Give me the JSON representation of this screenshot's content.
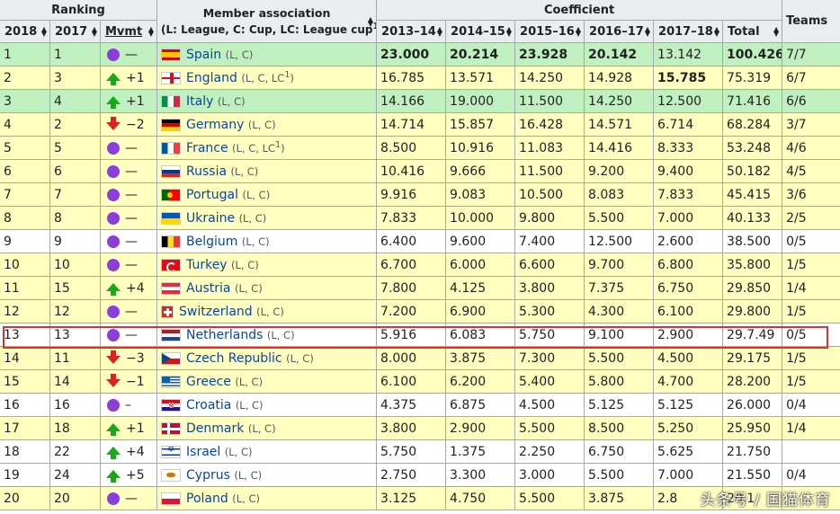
{
  "headers": {
    "ranking": "Ranking",
    "member_association": "Member association",
    "member_sub_prefix": "(L: League, C: Cup, LC: League cup",
    "member_sub_sup": "1",
    "member_sub_suffix": ")",
    "coefficient": "Coefficient",
    "teams": "Teams",
    "col_2018": "2018",
    "col_2017": "2017",
    "col_mvmt": "Mvmt",
    "col_1314": "2013–14",
    "col_1415": "2014–15",
    "col_1516": "2015–16",
    "col_1617": "2016–17",
    "col_1718": "2017–18",
    "col_total": "Total"
  },
  "rows": [
    {
      "r18": "1",
      "r17": "1",
      "icon": "dot-icon",
      "mv": "—",
      "flag": "es",
      "flag_icon": "spain-flag-icon",
      "country": "Spain",
      "sfx": "(L, C)",
      "sup": "",
      "c1314": "23.000",
      "c1415": "20.214",
      "c1516": "23.928",
      "c1617": "20.142",
      "c1718": "13.142",
      "total": "100.426",
      "teams": "7/7"
    },
    {
      "r18": "2",
      "r17": "3",
      "icon": "up-arrow-icon",
      "mv": "+1",
      "flag": "en",
      "flag_icon": "england-flag-icon",
      "country": "England",
      "sfx": "(L, C, LC",
      "sup": "1",
      "c1314": "16.785",
      "c1415": "13.571",
      "c1516": "14.250",
      "c1617": "14.928",
      "c1718": "15.785",
      "total": "75.319",
      "teams": "6/7"
    },
    {
      "r18": "3",
      "r17": "4",
      "icon": "up-arrow-icon",
      "mv": "+1",
      "flag": "it",
      "flag_icon": "italy-flag-icon",
      "country": "Italy",
      "sfx": "(L, C)",
      "sup": "",
      "c1314": "14.166",
      "c1415": "19.000",
      "c1516": "11.500",
      "c1617": "14.250",
      "c1718": "12.500",
      "total": "71.416",
      "teams": "6/6"
    },
    {
      "r18": "4",
      "r17": "2",
      "icon": "down-arrow-icon",
      "mv": "−2",
      "flag": "de",
      "flag_icon": "germany-flag-icon",
      "country": "Germany",
      "sfx": "(L, C)",
      "sup": "",
      "c1314": "14.714",
      "c1415": "15.857",
      "c1516": "16.428",
      "c1617": "14.571",
      "c1718": "6.714",
      "total": "68.284",
      "teams": "3/7"
    },
    {
      "r18": "5",
      "r17": "5",
      "icon": "dot-icon",
      "mv": "—",
      "flag": "fr",
      "flag_icon": "france-flag-icon",
      "country": "France",
      "sfx": "(L, C, LC",
      "sup": "1",
      "c1314": "8.500",
      "c1415": "10.916",
      "c1516": "11.083",
      "c1617": "14.416",
      "c1718": "8.333",
      "total": "53.248",
      "teams": "4/6"
    },
    {
      "r18": "6",
      "r17": "6",
      "icon": "dot-icon",
      "mv": "—",
      "flag": "ru",
      "flag_icon": "russia-flag-icon",
      "country": "Russia",
      "sfx": "(L, C)",
      "sup": "",
      "c1314": "10.416",
      "c1415": "9.666",
      "c1516": "11.500",
      "c1617": "9.200",
      "c1718": "9.400",
      "total": "50.182",
      "teams": "4/5"
    },
    {
      "r18": "7",
      "r17": "7",
      "icon": "dot-icon",
      "mv": "—",
      "flag": "pt",
      "flag_icon": "portugal-flag-icon",
      "country": "Portugal",
      "sfx": "(L, C)",
      "sup": "",
      "c1314": "9.916",
      "c1415": "9.083",
      "c1516": "10.500",
      "c1617": "8.083",
      "c1718": "7.833",
      "total": "45.415",
      "teams": "3/6"
    },
    {
      "r18": "8",
      "r17": "8",
      "icon": "dot-icon",
      "mv": "—",
      "flag": "ua",
      "flag_icon": "ukraine-flag-icon",
      "country": "Ukraine",
      "sfx": "(L, C)",
      "sup": "",
      "c1314": "7.833",
      "c1415": "10.000",
      "c1516": "9.800",
      "c1617": "5.500",
      "c1718": "7.000",
      "total": "40.133",
      "teams": "2/5"
    },
    {
      "r18": "9",
      "r17": "9",
      "icon": "dot-icon",
      "mv": "—",
      "flag": "be",
      "flag_icon": "belgium-flag-icon",
      "country": "Belgium",
      "sfx": "(L, C)",
      "sup": "",
      "c1314": "6.400",
      "c1415": "9.600",
      "c1516": "7.400",
      "c1617": "12.500",
      "c1718": "2.600",
      "total": "38.500",
      "teams": "0/5"
    },
    {
      "r18": "10",
      "r17": "10",
      "icon": "dot-icon",
      "mv": "—",
      "flag": "tr",
      "flag_icon": "turkey-flag-icon",
      "country": "Turkey",
      "sfx": "(L, C)",
      "sup": "",
      "c1314": "6.700",
      "c1415": "6.000",
      "c1516": "6.600",
      "c1617": "9.700",
      "c1718": "6.800",
      "total": "35.800",
      "teams": "1/5"
    },
    {
      "r18": "11",
      "r17": "15",
      "icon": "up-arrow-icon",
      "mv": "+4",
      "flag": "at",
      "flag_icon": "austria-flag-icon",
      "country": "Austria",
      "sfx": "(L, C)",
      "sup": "",
      "c1314": "7.800",
      "c1415": "4.125",
      "c1516": "3.800",
      "c1617": "7.375",
      "c1718": "6.750",
      "total": "29.850",
      "teams": "1/4"
    },
    {
      "r18": "12",
      "r17": "12",
      "icon": "dot-icon",
      "mv": "—",
      "flag": "ch",
      "flag_icon": "switzerland-flag-icon",
      "country": "Switzerland",
      "sfx": "(L, C)",
      "sup": "",
      "c1314": "7.200",
      "c1415": "6.900",
      "c1516": "5.300",
      "c1617": "4.300",
      "c1718": "6.100",
      "total": "29.800",
      "teams": "1/5"
    },
    {
      "r18": "13",
      "r17": "13",
      "icon": "dot-icon",
      "mv": "—",
      "flag": "nl",
      "flag_icon": "netherlands-flag-icon",
      "country": "Netherlands",
      "sfx": "(L, C)",
      "sup": "",
      "c1314": "5.916",
      "c1415": "6.083",
      "c1516": "5.750",
      "c1617": "9.100",
      "c1718": "2.900",
      "total": "29.7.49",
      "teams": "0/5"
    },
    {
      "r18": "14",
      "r17": "11",
      "icon": "down-arrow-icon",
      "mv": "−3",
      "flag": "cz",
      "flag_icon": "czech-flag-icon",
      "country": "Czech Republic",
      "sfx": "(L, C)",
      "sup": "",
      "c1314": "8.000",
      "c1415": "3.875",
      "c1516": "7.300",
      "c1617": "5.500",
      "c1718": "4.500",
      "total": "29.175",
      "teams": "1/5"
    },
    {
      "r18": "15",
      "r17": "14",
      "icon": "down-arrow-icon",
      "mv": "−1",
      "flag": "gr",
      "flag_icon": "greece-flag-icon",
      "country": "Greece",
      "sfx": "(L, C)",
      "sup": "",
      "c1314": "6.100",
      "c1415": "6.200",
      "c1516": "5.400",
      "c1617": "5.800",
      "c1718": "4.700",
      "total": "28.200",
      "teams": "1/5"
    },
    {
      "r18": "16",
      "r17": "16",
      "icon": "dot-icon",
      "mv": "–",
      "flag": "hr",
      "flag_icon": "croatia-flag-icon",
      "country": "Croatia",
      "sfx": "(L, C)",
      "sup": "",
      "c1314": "4.375",
      "c1415": "6.875",
      "c1516": "4.500",
      "c1617": "5.125",
      "c1718": "5.125",
      "total": "26.000",
      "teams": "0/4"
    },
    {
      "r18": "17",
      "r17": "18",
      "icon": "up-arrow-icon",
      "mv": "+1",
      "flag": "dk",
      "flag_icon": "denmark-flag-icon",
      "country": "Denmark",
      "sfx": "(L, C)",
      "sup": "",
      "c1314": "3.800",
      "c1415": "2.900",
      "c1516": "5.500",
      "c1617": "8.500",
      "c1718": "5.250",
      "total": "25.950",
      "teams": "1/4"
    },
    {
      "r18": "18",
      "r17": "22",
      "icon": "up-arrow-icon",
      "mv": "+4",
      "flag": "il",
      "flag_icon": "israel-flag-icon",
      "country": "Israel",
      "sfx": "(L, C)",
      "sup": "",
      "c1314": "5.750",
      "c1415": "1.375",
      "c1516": "2.250",
      "c1617": "6.750",
      "c1718": "5.625",
      "total": "21.750",
      "teams": ""
    },
    {
      "r18": "19",
      "r17": "24",
      "icon": "up-arrow-icon",
      "mv": "+5",
      "flag": "cy",
      "flag_icon": "cyprus-flag-icon",
      "country": "Cyprus",
      "sfx": "(L, C)",
      "sup": "",
      "c1314": "2.750",
      "c1415": "3.300",
      "c1516": "3.000",
      "c1617": "5.500",
      "c1718": "7.000",
      "total": "21.550",
      "teams": "0/4"
    },
    {
      "r18": "20",
      "r17": "20",
      "icon": "dot-icon",
      "mv": "—",
      "flag": "pl",
      "flag_icon": "poland-flag-icon",
      "country": "Poland",
      "sfx": "(L, C)",
      "sup": "",
      "c1314": "3.125",
      "c1415": "4.750",
      "c1516": "5.500",
      "c1617": "3.875",
      "c1718": "2.8",
      "total": "20.1",
      "teams": ""
    }
  ],
  "row_styles": [
    "green",
    "yellow",
    "green",
    "yellow",
    "yellow",
    "yellow",
    "yellow",
    "yellow",
    "white",
    "yellow",
    "yellow",
    "yellow",
    "white",
    "yellow",
    "yellow",
    "white",
    "yellow",
    "white",
    "white",
    "yellow"
  ],
  "bold_cells": {
    "0": [
      "c1314",
      "c1415",
      "c1516",
      "c1617",
      "total"
    ],
    "1": [
      "c1718"
    ]
  },
  "highlighted_row": "13",
  "watermark": "头条号 / 国猫体育",
  "colors": {
    "header_bg": "#eaecf0",
    "yellow_row": "#ffffc0",
    "green_row": "#c0f0c0",
    "link": "#0645ad",
    "highlight_border": "#e0322c",
    "dot": "#8b3fd9",
    "up": "#18a818",
    "down": "#dd2222"
  }
}
